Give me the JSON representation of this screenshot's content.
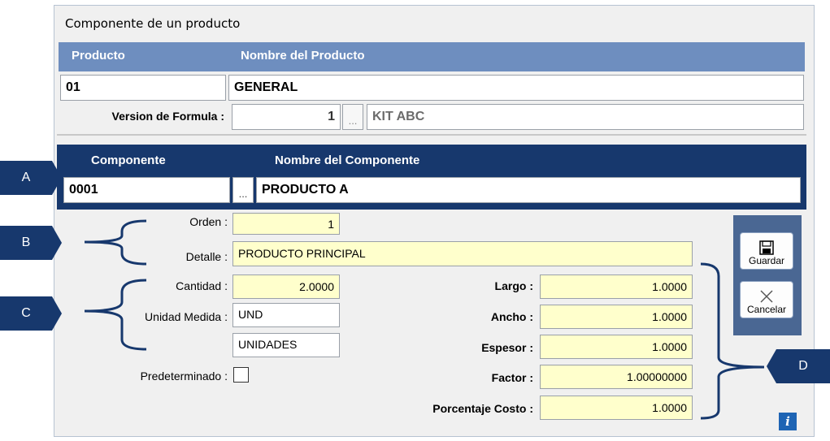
{
  "window": {
    "title": "Componente de un producto"
  },
  "producto": {
    "col_producto": "Producto",
    "col_nombre": "Nombre del Producto",
    "code": "01",
    "name": "GENERAL",
    "version_label": "Version de Formula :",
    "version_value": "1",
    "version_button": "...",
    "version_name": "KIT ABC"
  },
  "componente": {
    "col_componente": "Componente",
    "col_nombre": "Nombre del Componente",
    "code": "0001",
    "lookup_button": "...",
    "name": "PRODUCTO A"
  },
  "form": {
    "orden_label": "Orden :",
    "orden_value": "1",
    "detalle_label": "Detalle :",
    "detalle_value": "PRODUCTO PRINCIPAL",
    "cantidad_label": "Cantidad :",
    "cantidad_value": "2.0000",
    "unidad_label": "Unidad Medida :",
    "unidad_code": "UND",
    "unidad_name": "UNIDADES",
    "predeterminado_label": "Predeterminado :",
    "largo_label": "Largo :",
    "largo_value": "1.0000",
    "ancho_label": "Ancho :",
    "ancho_value": "1.0000",
    "espesor_label": "Espesor :",
    "espesor_value": "1.0000",
    "factor_label": "Factor :",
    "factor_value": "1.00000000",
    "porcentaje_label": "Porcentaje Costo :",
    "porcentaje_value": "1.0000"
  },
  "actions": {
    "guardar": "Guardar",
    "cancelar": "Cancelar"
  },
  "callouts": {
    "a": "A",
    "b": "B",
    "c": "C",
    "d": "D"
  },
  "colors": {
    "header_light": "#6e8ebf",
    "header_dark": "#17386d",
    "field_yellow": "#ffffcc"
  },
  "icons": {
    "save": "floppy-disk-icon",
    "cancel": "x-cross-icon",
    "info": "info-icon"
  }
}
